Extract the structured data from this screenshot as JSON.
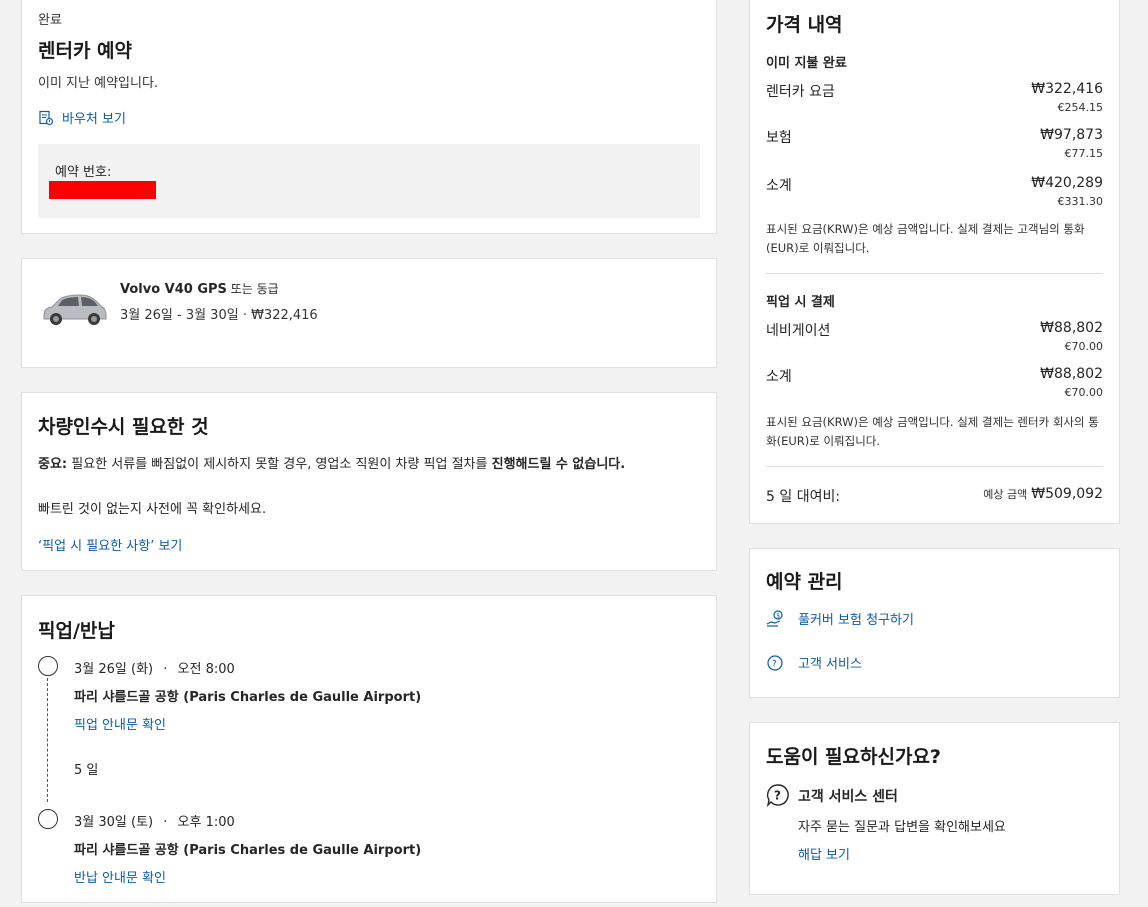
{
  "booking": {
    "status": "완료",
    "title": "렌터카 예약",
    "subtitle": "이미 지난 예약입니다.",
    "voucher_link": "바우처 보기",
    "ref_label": "예약 번호:"
  },
  "car": {
    "name": "Volvo V40 GPS",
    "name_suffix": " 또는 동급",
    "details": "3월 26일 - 3월 30일 · ₩322,416"
  },
  "docs": {
    "title": "차량인수시 필요한 것",
    "important_prefix": "중요:",
    "important_text": " 필요한 서류를 빠짐없이 제시하지 못할 경우, 영업소 직원이 차량 픽업 절차를 ",
    "important_bold": "진행해드릴 수 없습니다",
    "line2": "빠트린 것이 없는지 사전에 꼭 확인하세요.",
    "link": "‘픽업 시 필요한 사항’ 보기"
  },
  "pickup": {
    "title": "픽업/반납",
    "pickup_date": "3월 26일 (화)",
    "pickup_time": "오전 8:00",
    "pickup_place_ko": "파리 샤를드골 공항",
    "pickup_place_en": " (Paris Charles de Gaulle Airport)",
    "pickup_link": "픽업 안내문 확인",
    "duration": "5 일",
    "return_date": "3월 30일 (토)",
    "return_time": "오후 1:00",
    "return_place_ko": "파리 샤를드골 공항",
    "return_place_en": " (Paris Charles de Gaulle Airport)",
    "return_link": "반납 안내문 확인",
    "sep": "·"
  },
  "price": {
    "title": "가격 내역",
    "paid_heading": "이미 지불 완료",
    "rows_paid": [
      {
        "label": "렌터카 요금",
        "krw": "₩322,416",
        "eur": "€254.15"
      },
      {
        "label": "보험",
        "krw": "₩97,873",
        "eur": "€77.15"
      },
      {
        "label": "소계",
        "krw": "₩420,289",
        "eur": "€331.30"
      }
    ],
    "note_paid": "표시된 요금(KRW)은 예상 금액입니다. 실제 결제는 고객님의 통화(EUR)로 이뤄집니다.",
    "pickup_heading": "픽업 시 결제",
    "rows_pickup": [
      {
        "label": "네비게이션",
        "krw": "₩88,802",
        "eur": "€70.00"
      },
      {
        "label": "소계",
        "krw": "₩88,802",
        "eur": "€70.00"
      }
    ],
    "note_pickup": "표시된 요금(KRW)은 예상 금액입니다. 실제 결제는 렌터카 회사의 통화(EUR)로 이뤄집니다.",
    "total_label": "5 일 대여비:",
    "total_prefix": "예상 금액",
    "total_amount": "₩509,092"
  },
  "manage": {
    "title": "예약 관리",
    "claim_link": "풀커버 보험 청구하기",
    "service_link": "고객 서비스"
  },
  "help": {
    "title": "도움이 필요하신가요?",
    "center_title": "고객 서비스 센터",
    "center_desc": "자주 묻는 질문과 답변을 확인해보세요",
    "answer_link": "해답 보기"
  },
  "icons": {
    "voucher": "voucher-icon",
    "car": "car-image",
    "claim": "insurance-claim-icon",
    "service": "customer-service-icon",
    "help": "question-bubble-icon"
  },
  "colors": {
    "link": "#0b5cad",
    "redaction": "#ff0000"
  }
}
